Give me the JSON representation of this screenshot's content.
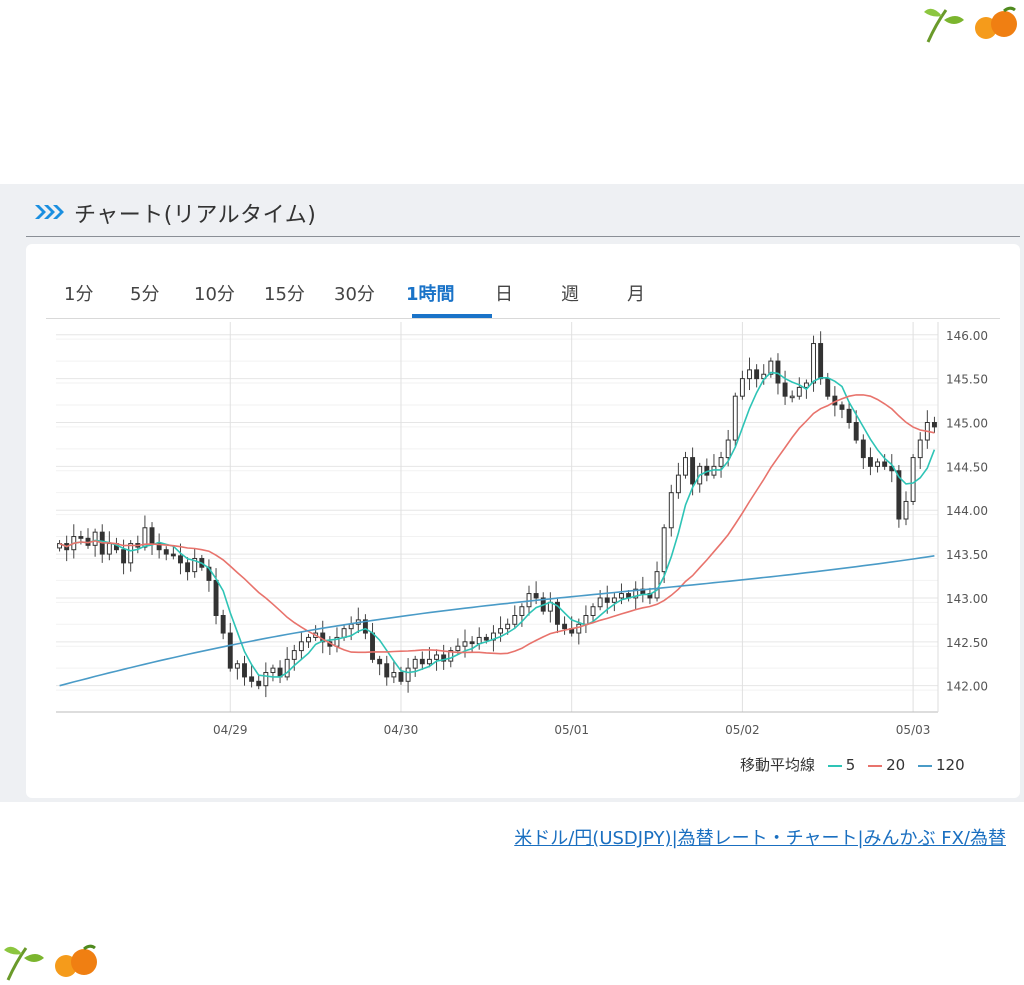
{
  "header": {
    "title": "チャート(リアルタイム)"
  },
  "tabs": [
    {
      "label": "1分",
      "active": false
    },
    {
      "label": "5分",
      "active": false
    },
    {
      "label": "10分",
      "active": false
    },
    {
      "label": "15分",
      "active": false
    },
    {
      "label": "30分",
      "active": false
    },
    {
      "label": "1時間",
      "active": true
    },
    {
      "label": "日",
      "active": false
    },
    {
      "label": "週",
      "active": false
    },
    {
      "label": "月",
      "active": false
    }
  ],
  "legend": {
    "title": "移動平均線",
    "items": [
      {
        "label": "5",
        "color": "#2ec4b6"
      },
      {
        "label": "20",
        "color": "#e8736c"
      },
      {
        "label": "120",
        "color": "#4a9bc7"
      }
    ]
  },
  "source_link": {
    "text": "米ドル/円(USDJPY)|為替レート・チャート|みんかぶ FX/為替"
  },
  "colors": {
    "accent": "#1a73c8",
    "panel_bg": "#eef0f3"
  },
  "chart_data": {
    "type": "candlestick",
    "ylim": [
      141.7,
      146.1
    ],
    "yticks": [
      142.0,
      142.5,
      143.0,
      143.5,
      144.0,
      144.5,
      145.0,
      145.5,
      146.0
    ],
    "ytick_labels": [
      "142.00",
      "142.50",
      "143.00",
      "143.50",
      "144.00",
      "144.50",
      "145.00",
      "145.50",
      "146.00"
    ],
    "xticks": [
      {
        "label": "04/29",
        "index": 24
      },
      {
        "label": "04/30",
        "index": 48
      },
      {
        "label": "05/01",
        "index": 72
      },
      {
        "label": "05/02",
        "index": 96
      },
      {
        "label": "05/03",
        "index": 120
      }
    ],
    "candle_count": 124,
    "closes": [
      143.62,
      143.55,
      143.7,
      143.68,
      143.6,
      143.75,
      143.5,
      143.62,
      143.55,
      143.4,
      143.62,
      143.58,
      143.8,
      143.62,
      143.55,
      143.5,
      143.48,
      143.4,
      143.3,
      143.45,
      143.35,
      143.2,
      142.8,
      142.6,
      142.2,
      142.25,
      142.1,
      142.05,
      142.0,
      142.15,
      142.2,
      142.1,
      142.3,
      142.4,
      142.5,
      142.55,
      142.6,
      142.5,
      142.45,
      142.55,
      142.65,
      142.7,
      142.75,
      142.6,
      142.3,
      142.25,
      142.1,
      142.15,
      142.05,
      142.2,
      142.3,
      142.25,
      142.3,
      142.35,
      142.28,
      142.4,
      142.45,
      142.5,
      142.48,
      142.55,
      142.52,
      142.6,
      142.65,
      142.7,
      142.8,
      142.9,
      143.05,
      143.0,
      142.85,
      142.95,
      142.7,
      142.65,
      142.6,
      142.7,
      142.8,
      142.9,
      143.0,
      142.95,
      143.0,
      143.05,
      143.0,
      143.1,
      143.05,
      143.0,
      143.3,
      143.8,
      144.2,
      144.4,
      144.6,
      144.3,
      144.5,
      144.4,
      144.5,
      144.6,
      144.8,
      145.3,
      145.5,
      145.6,
      145.5,
      145.55,
      145.7,
      145.45,
      145.3,
      145.3,
      145.4,
      145.45,
      145.9,
      145.5,
      145.3,
      145.2,
      145.15,
      145.0,
      144.8,
      144.6,
      144.5,
      144.55,
      144.5,
      144.45,
      143.9,
      144.1,
      144.6,
      144.8,
      145.0,
      144.95
    ],
    "series": [
      {
        "name": "5",
        "period": 5,
        "color": "#2ec4b6"
      },
      {
        "name": "20",
        "period": 20,
        "color": "#e8736c"
      },
      {
        "name": "120",
        "period": 120,
        "color": "#4a9bc7",
        "line": {
          "start": 142.0,
          "end": 143.48
        }
      }
    ]
  }
}
